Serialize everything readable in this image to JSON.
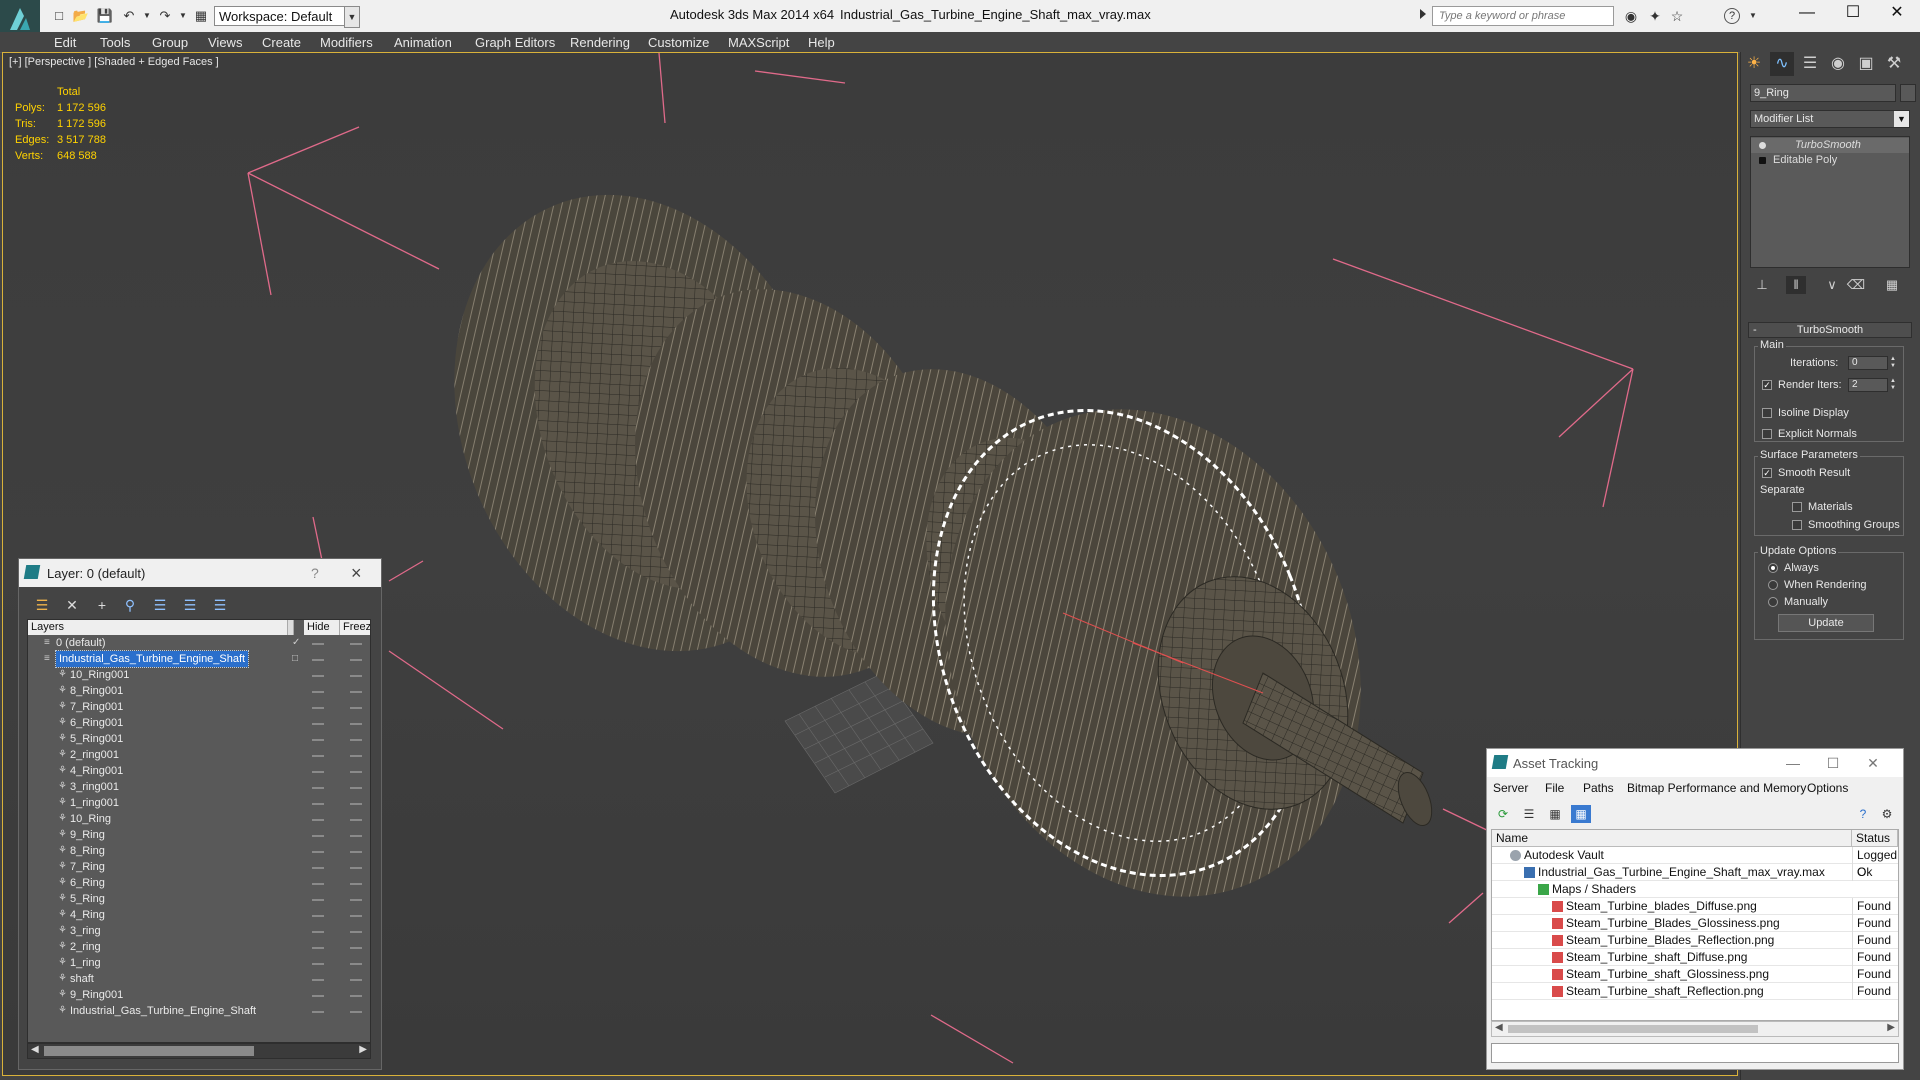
{
  "titlebar": {
    "workspace": "Workspace: Default",
    "app_title": "Autodesk 3ds Max  2014 x64",
    "file_title": "Industrial_Gas_Turbine_Engine_Shaft_max_vray.max",
    "search_placeholder": "Type a keyword or phrase",
    "icons": [
      "binoculars-icon",
      "star-search-icon",
      "star-icon",
      "help-icon"
    ]
  },
  "menu": [
    "Edit",
    "Tools",
    "Group",
    "Views",
    "Create",
    "Modifiers",
    "Animation",
    "Graph Editors",
    "Rendering",
    "Customize",
    "MAXScript",
    "Help"
  ],
  "viewport": {
    "label": "[+] [Perspective ] [Shaded + Edged Faces ]",
    "stats": {
      "header": "Total",
      "rows": [
        {
          "label": "Polys:",
          "value": "1 172 596"
        },
        {
          "label": "Tris:",
          "value": "1 172 596"
        },
        {
          "label": "Edges:",
          "value": "3 517 788"
        },
        {
          "label": "Verts:",
          "value": "648 588"
        }
      ]
    }
  },
  "command_panel": {
    "object_name": "9_Ring",
    "modifier_list": "Modifier List",
    "stack": [
      "TurboSmooth",
      "Editable Poly"
    ],
    "rollout_title": "TurboSmooth",
    "main_group": "Main",
    "iterations_label": "Iterations:",
    "iterations_value": "0",
    "render_iters_label": "Render Iters:",
    "render_iters_value": "2",
    "isoline_label": "Isoline Display",
    "explicit_normals_label": "Explicit Normals",
    "surface_group": "Surface Parameters",
    "smooth_result_label": "Smooth Result",
    "separate_label": "Separate",
    "materials_label": "Materials",
    "smoothing_groups_label": "Smoothing Groups",
    "update_group": "Update Options",
    "always_label": "Always",
    "when_rendering_label": "When Rendering",
    "manually_label": "Manually",
    "update_button": "Update"
  },
  "layer_dialog": {
    "title": "Layer: 0 (default)",
    "help": "?",
    "columns": [
      "Layers",
      "Hide",
      "Freeze"
    ],
    "rows": [
      {
        "name": "0 (default)",
        "level": 0,
        "type": "layer"
      },
      {
        "name": "Industrial_Gas_Turbine_Engine_Shaft",
        "level": 0,
        "type": "layer",
        "selected": true
      },
      {
        "name": "10_Ring001",
        "level": 1,
        "type": "object"
      },
      {
        "name": "8_Ring001",
        "level": 1,
        "type": "object"
      },
      {
        "name": "7_Ring001",
        "level": 1,
        "type": "object"
      },
      {
        "name": "6_Ring001",
        "level": 1,
        "type": "object"
      },
      {
        "name": "5_Ring001",
        "level": 1,
        "type": "object"
      },
      {
        "name": "2_ring001",
        "level": 1,
        "type": "object"
      },
      {
        "name": "4_Ring001",
        "level": 1,
        "type": "object"
      },
      {
        "name": "3_ring001",
        "level": 1,
        "type": "object"
      },
      {
        "name": "1_ring001",
        "level": 1,
        "type": "object"
      },
      {
        "name": "10_Ring",
        "level": 1,
        "type": "object"
      },
      {
        "name": "9_Ring",
        "level": 1,
        "type": "object"
      },
      {
        "name": "8_Ring",
        "level": 1,
        "type": "object"
      },
      {
        "name": "7_Ring",
        "level": 1,
        "type": "object"
      },
      {
        "name": "6_Ring",
        "level": 1,
        "type": "object"
      },
      {
        "name": "5_Ring",
        "level": 1,
        "type": "object"
      },
      {
        "name": "4_Ring",
        "level": 1,
        "type": "object"
      },
      {
        "name": "3_ring",
        "level": 1,
        "type": "object"
      },
      {
        "name": "2_ring",
        "level": 1,
        "type": "object"
      },
      {
        "name": "1_ring",
        "level": 1,
        "type": "object"
      },
      {
        "name": "shaft",
        "level": 1,
        "type": "object"
      },
      {
        "name": "9_Ring001",
        "level": 1,
        "type": "object"
      },
      {
        "name": "Industrial_Gas_Turbine_Engine_Shaft",
        "level": 1,
        "type": "object"
      }
    ]
  },
  "asset_dialog": {
    "title": "Asset Tracking",
    "menu": [
      "Server",
      "File",
      "Paths",
      "Bitmap Performance and Memory",
      "Options"
    ],
    "columns": [
      "Name",
      "Status"
    ],
    "rows": [
      {
        "name": "Autodesk Vault",
        "status": "Logged O",
        "level": 0,
        "icon": "vault"
      },
      {
        "name": "Industrial_Gas_Turbine_Engine_Shaft_max_vray.max",
        "status": "Ok",
        "level": 1,
        "icon": "max"
      },
      {
        "name": "Maps / Shaders",
        "status": "",
        "level": 2,
        "icon": "folder"
      },
      {
        "name": "Steam_Turbine_blades_Diffuse.png",
        "status": "Found",
        "level": 3,
        "icon": "png"
      },
      {
        "name": "Steam_Turbine_Blades_Glossiness.png",
        "status": "Found",
        "level": 3,
        "icon": "png"
      },
      {
        "name": "Steam_Turbine_Blades_Reflection.png",
        "status": "Found",
        "level": 3,
        "icon": "png"
      },
      {
        "name": "Steam_Turbine_shaft_Diffuse.png",
        "status": "Found",
        "level": 3,
        "icon": "png"
      },
      {
        "name": "Steam_Turbine_shaft_Glossiness.png",
        "status": "Found",
        "level": 3,
        "icon": "png"
      },
      {
        "name": "Steam_Turbine_shaft_Reflection.png",
        "status": "Found",
        "level": 3,
        "icon": "png"
      }
    ]
  },
  "colors": {
    "viewport_border": "#d9b23a",
    "stats_text": "#ffd200",
    "selection_blue": "#2a6fcc",
    "gizmo_pink": "#e06a8a"
  }
}
